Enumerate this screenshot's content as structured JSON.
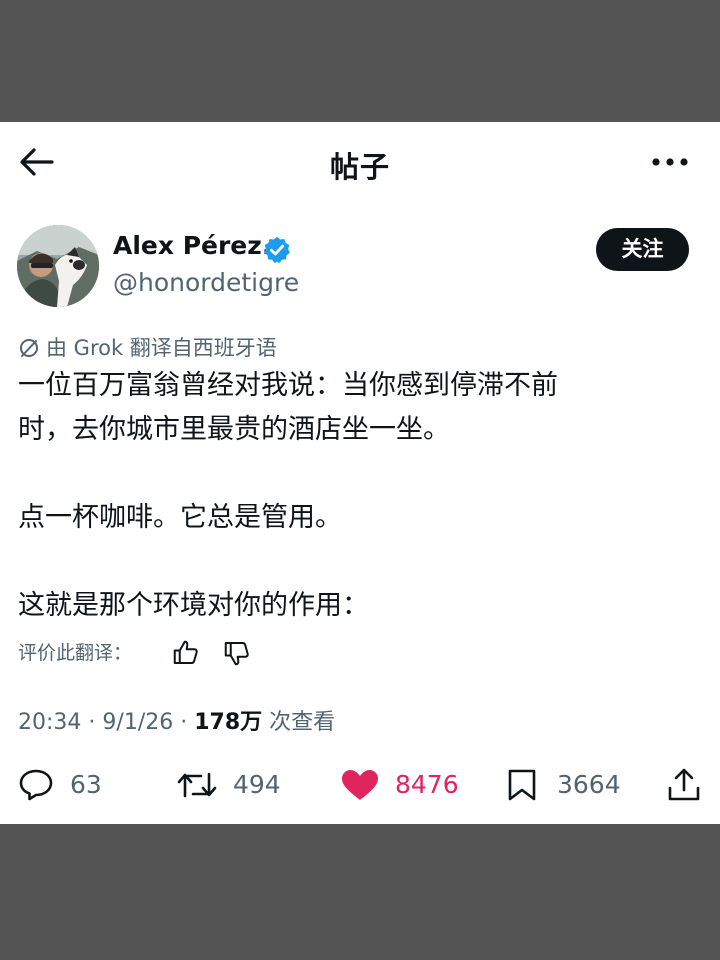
{
  "header": {
    "title": "帖子"
  },
  "author": {
    "name": "Alex Pérez.",
    "handle": "@honordetigre",
    "follow_label": "关注"
  },
  "translation_note": "由 Grok 翻译自西班牙语",
  "tweet": {
    "lines": [
      "一位百万富翁曾经对我说：当你感到停滞不前",
      "时，去你城市里最贵的酒店坐一坐。",
      "",
      "点一杯咖啡。它总是管用。",
      "",
      "这就是那个环境对你的作用："
    ]
  },
  "rate_translation_label": "评价此翻译：",
  "meta": {
    "time": "20:34",
    "date": "9/1/26",
    "views": "178万",
    "views_suffix": "次查看"
  },
  "actions": {
    "replies": "63",
    "retweets": "494",
    "likes": "8476",
    "bookmarks": "3664"
  },
  "colors": {
    "like": "#e0245e",
    "verified": "#1d9bf0",
    "muted_text": "#536471",
    "follow_button": "#0f1419"
  },
  "icons": [
    "back-arrow-icon",
    "more-icon",
    "verified-icon",
    "grok-icon",
    "thumbs-up-icon",
    "thumbs-down-icon",
    "reply-icon",
    "retweet-icon",
    "heart-icon",
    "bookmark-icon",
    "share-icon"
  ]
}
